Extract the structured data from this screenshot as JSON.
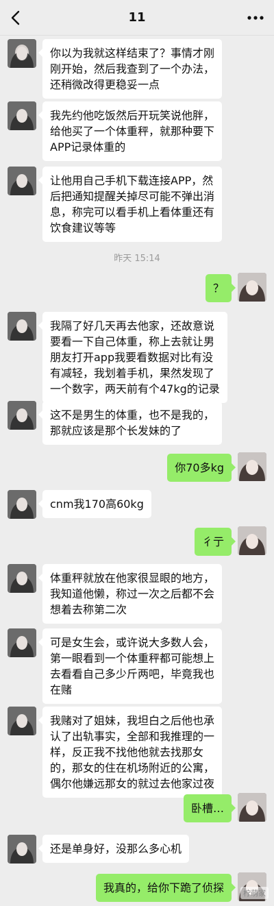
{
  "header": {
    "title": "11",
    "back_icon": "chevron-left-icon",
    "more_icon": "more-icon"
  },
  "messages": [
    {
      "side": "left",
      "text": "你以为我就这样结束了？事情才刚\n刚开始，然后我查到了一个办法，\n还稍微改得更稳妥一点"
    },
    {
      "side": "left",
      "text": "我先约他吃饭然后开玩笑说他胖，\n给他买了一个体重秤，就那种要下\nAPP记录体重的"
    },
    {
      "side": "left",
      "text": "让他用自己手机下载连接APP，然\n后把通知提醒关掉尽可能不弹出消\n息，称完可以看手机上看体重还有\n饮食建议等等"
    },
    {
      "timestamp": "昨天 15:14"
    },
    {
      "side": "right",
      "text": "？"
    },
    {
      "side": "left",
      "text": "我隔了好几天再去他家，还故意说\n要看一下自己体重，称上去就让男\n朋友打开app我要看数据对比有没\n有减轻，我划着手机，果然发现了\n一个数字，两天前有个47kg的记录"
    },
    {
      "side": "left",
      "text": "这不是男生的体重，也不是我的，\n那就应该是那个长发妹的了"
    },
    {
      "side": "right",
      "text": "你70多kg"
    },
    {
      "side": "left",
      "text": "cnm我170高60kg"
    },
    {
      "side": "right",
      "text": "彳亍"
    },
    {
      "side": "left",
      "text": "体重秤就放在他家很显眼的地方，\n我知道他懒，称过一次之后都不会\n想着去称第二次"
    },
    {
      "side": "left",
      "text": "可是女生会，或许说大多数人会，\n第一眼看到一个体重秤都可能想上\n去看看自己多少斤两吧，毕竟我也\n在赌"
    },
    {
      "side": "left",
      "text": "我赌对了姐妹，我坦白之后他也承\n认了出轨事实，全部和我推理的一\n样，反正我不找他他就去找那女\n的，那女的住在机场附近的公寓，\n偶尔他嫌远那女的就过去他家过夜"
    },
    {
      "side": "right",
      "text": "卧槽…"
    },
    {
      "side": "left",
      "text": "还是单身好，没那么多心机"
    },
    {
      "side": "right",
      "text": "我真的，给你下跪了侦探"
    }
  ],
  "watermark": "柠萌家"
}
